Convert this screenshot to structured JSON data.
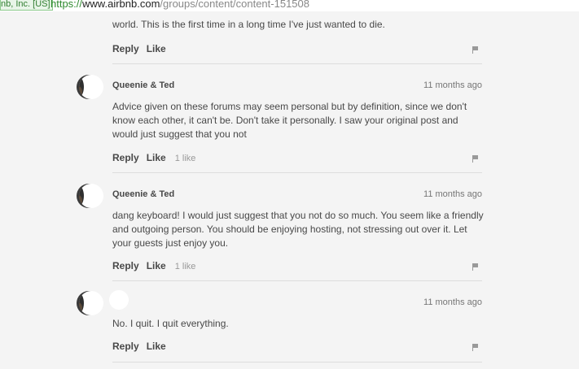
{
  "address_bar": {
    "cert_label": "nb, Inc. [US]",
    "url_scheme": "https://",
    "url_host": "www.airbnb.com",
    "url_path": "/groups/content/content-151508"
  },
  "comments": [
    {
      "text_tail": "world. This is the first time in a long time I've just wanted to die.",
      "reply_label": "Reply",
      "like_label": "Like"
    },
    {
      "author": "Queenie & Ted",
      "time": "11 months ago",
      "text": "Advice given on these forums may seem personal but by definition, since we don't know each other, it can't be. Don't take it personally. I saw your original post and would just suggest that you not",
      "reply_label": "Reply",
      "like_label": "Like",
      "likes": "1 like"
    },
    {
      "author": "Queenie & Ted",
      "time": "11 months ago",
      "text": "dang keyboard! I would just suggest that you not do so much. You seem like a friendly and outgoing person. You should be enjoying hosting, not stressing out over it. Let your guests just enjoy you.",
      "reply_label": "Reply",
      "like_label": "Like",
      "likes": "1 like"
    },
    {
      "author": "",
      "time": "11 months ago",
      "text": "No. I quit. I quit everything.",
      "reply_label": "Reply",
      "like_label": "Like"
    }
  ],
  "icons": {
    "flag": "flag-icon",
    "avatar": "avatar"
  }
}
